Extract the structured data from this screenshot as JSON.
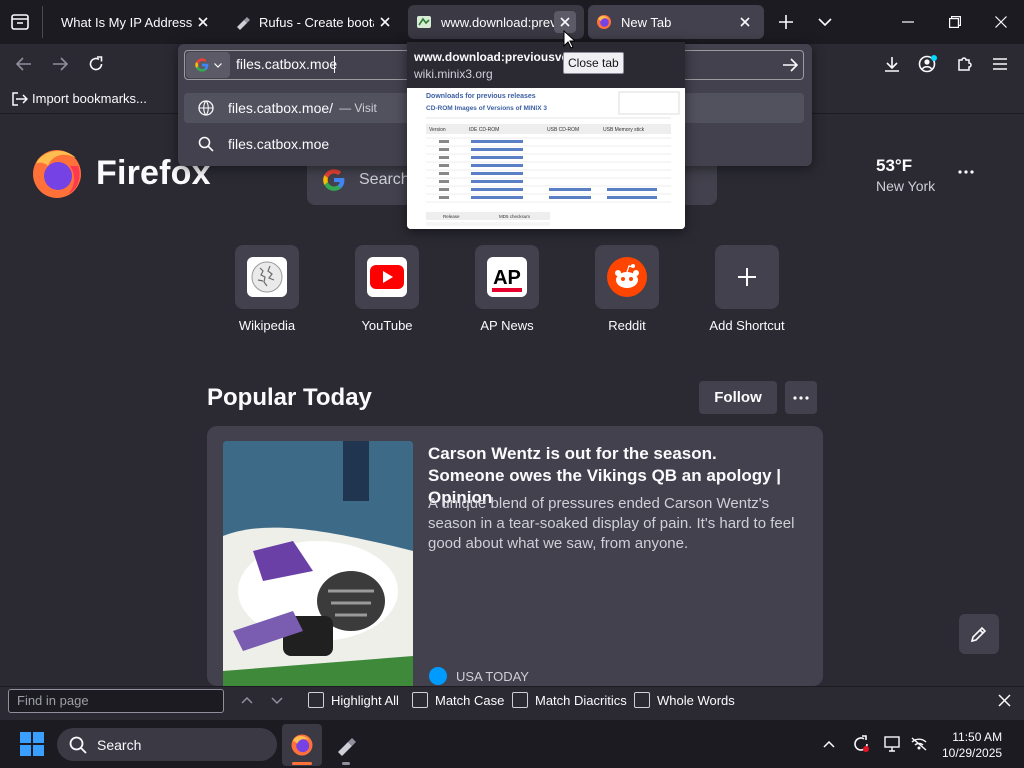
{
  "tabs": [
    {
      "title": "What Is My IP Address - See",
      "state": "normal"
    },
    {
      "title": "Rufus - Create bootable USB",
      "state": "normal"
    },
    {
      "title": "www.download:previousversions",
      "state": "hover"
    },
    {
      "title": "New Tab",
      "state": "selected"
    }
  ],
  "urlbar": {
    "value": "files.catbox.moe",
    "suggestions": [
      {
        "text": "files.catbox.moe/",
        "suffix": "— Visit"
      },
      {
        "text": "files.catbox.moe"
      }
    ]
  },
  "bookmarks": {
    "import_label": "Import bookmarks..."
  },
  "tab_preview": {
    "title": "www.download:previousversions]",
    "url": "wiki.minix3.org",
    "page_heading": "Downloads for previous releases",
    "page_subheading": "CD-ROM Images of Versions of MINIX 3",
    "table_headers": [
      "Version",
      "IDE CD-ROM",
      "USB CD-ROM",
      "USB Memory stick"
    ],
    "footer_headers": [
      "Release",
      "MD5 checksum"
    ]
  },
  "tooltip": "Close tab",
  "newtab": {
    "logo_text": "Firefox",
    "search_placeholder": "Search",
    "weather": {
      "temp": "53°F",
      "city": "New York"
    },
    "shortcuts": [
      {
        "label": "Wikipedia",
        "icon": "wikipedia-icon"
      },
      {
        "label": "YouTube",
        "icon": "youtube-icon"
      },
      {
        "label": "AP News",
        "icon": "ap-news-icon"
      },
      {
        "label": "Reddit",
        "icon": "reddit-icon"
      },
      {
        "label": "Add Shortcut",
        "icon": "plus-icon"
      }
    ],
    "section_title": "Popular Today",
    "follow_label": "Follow",
    "story": {
      "headline": "Carson Wentz is out for the season. Someone owes the Vikings QB an apology | Opinion",
      "excerpt": "A unique blend of pressures ended Carson Wentz's season in a tear-soaked display of pain. It's hard to feel good about what we saw, from anyone.",
      "source": "USA TODAY"
    }
  },
  "findbar": {
    "placeholder": "Find in page",
    "options": [
      "Highlight All",
      "Match Case",
      "Match Diacritics",
      "Whole Words"
    ]
  },
  "taskbar": {
    "search_label": "Search",
    "time": "11:50 AM",
    "date": "10/29/2025"
  }
}
